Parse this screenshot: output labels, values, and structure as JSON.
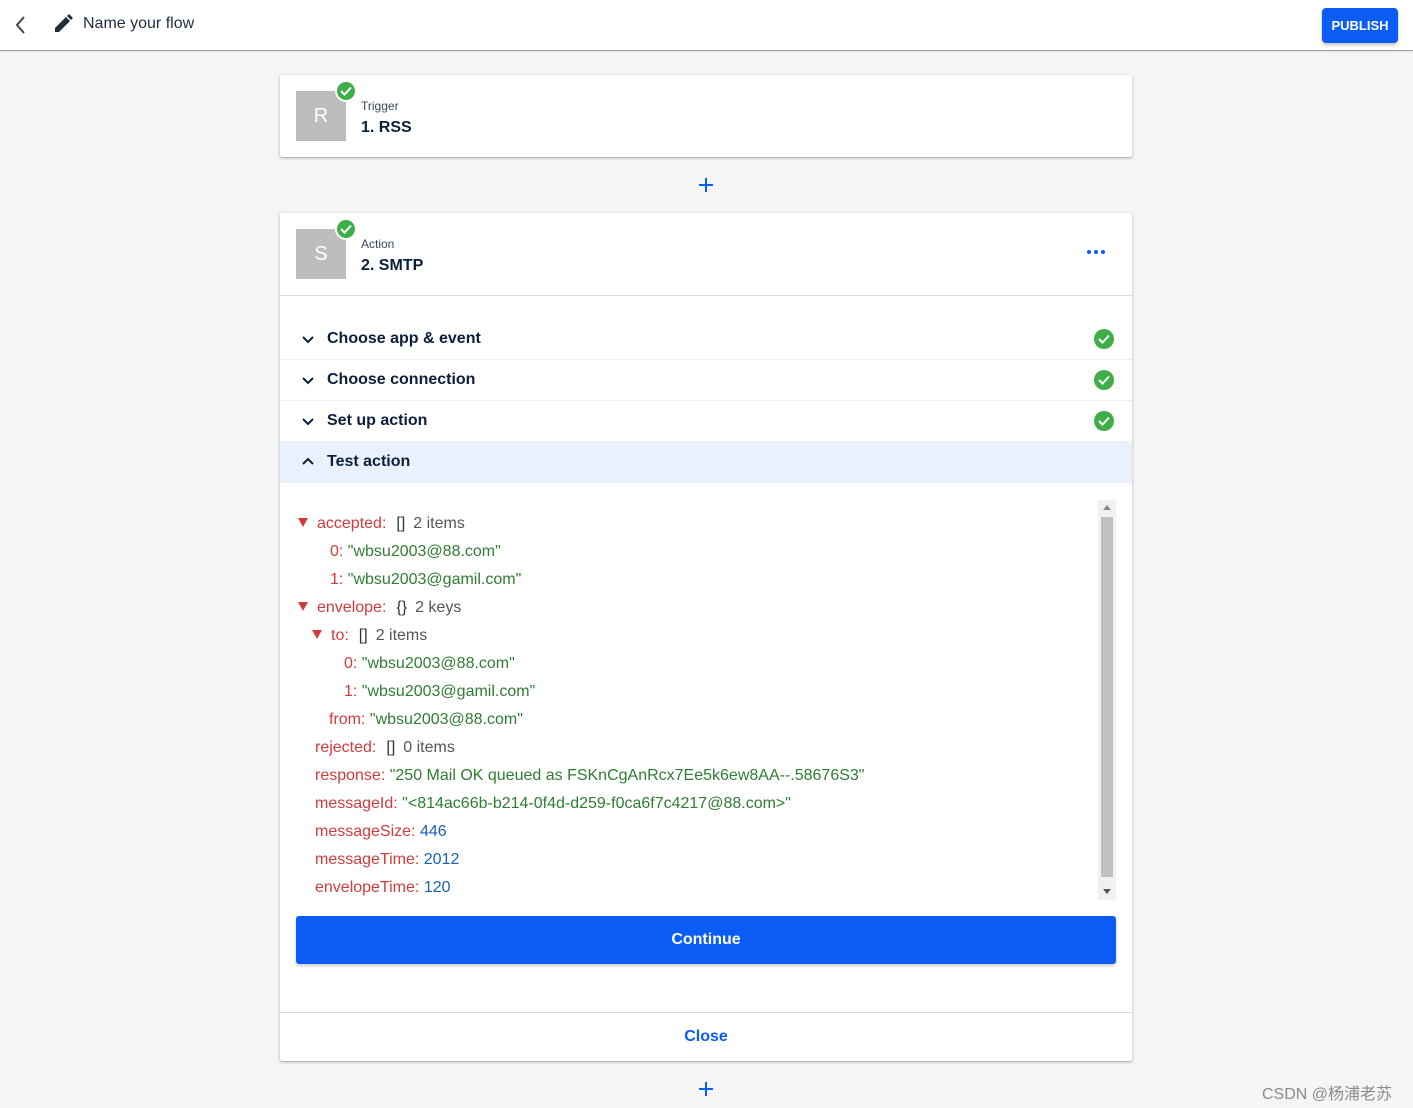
{
  "header": {
    "flow_name": "Name your flow",
    "publish_label": "PUBLISH"
  },
  "trigger": {
    "tile_letter": "R",
    "type": "Trigger",
    "name": "1. RSS"
  },
  "action": {
    "tile_letter": "S",
    "type": "Action",
    "name": "2. SMTP",
    "sections": [
      {
        "label": "Choose app & event",
        "complete": true
      },
      {
        "label": "Choose connection",
        "complete": true
      },
      {
        "label": "Set up action",
        "complete": true
      },
      {
        "label": "Test action",
        "complete": false,
        "open": true
      }
    ],
    "continue_label": "Continue",
    "close_label": "Close"
  },
  "test_result": {
    "accepted": {
      "key": "accepted:",
      "bracket": "[]",
      "meta": "2 items",
      "items": [
        {
          "idx": "0:",
          "val": "\"wbsu2003@88.com\""
        },
        {
          "idx": "1:",
          "val": "\"wbsu2003@gamil.com\""
        }
      ]
    },
    "envelope": {
      "key": "envelope:",
      "bracket": "{}",
      "meta": "2 keys",
      "to": {
        "key": "to:",
        "bracket": "[]",
        "meta": "2 items",
        "items": [
          {
            "idx": "0:",
            "val": "\"wbsu2003@88.com\""
          },
          {
            "idx": "1:",
            "val": "\"wbsu2003@gamil.com\""
          }
        ]
      },
      "from": {
        "key": "from:",
        "val": "\"wbsu2003@88.com\""
      }
    },
    "rejected": {
      "key": "rejected:",
      "bracket": "[]",
      "meta": "0 items"
    },
    "response": {
      "key": "response:",
      "val": "\"250 Mail OK queued as FSKnCgAnRcx7Ee5k6ew8AA--.58676S3\""
    },
    "messageId": {
      "key": "messageId:",
      "val": "\"<814ac66b-b214-0f4d-d259-f0ca6f7c4217@88.com>\""
    },
    "messageSize": {
      "key": "messageSize:",
      "val": "446"
    },
    "messageTime": {
      "key": "messageTime:",
      "val": "2012"
    },
    "envelopeTime": {
      "key": "envelopeTime:",
      "val": "120"
    }
  },
  "watermark": "CSDN @杨浦老苏",
  "colors": {
    "accent": "#0a5cf5",
    "success": "#3fae49",
    "json_key": "#d23b3b",
    "json_string": "#2e7d32",
    "json_number": "#1a5fb4"
  },
  "icons": {
    "back": "chevron-left-icon",
    "edit": "pencil-icon",
    "add": "plus-icon",
    "more": "more-horizontal-icon",
    "check": "check-circle-icon"
  }
}
